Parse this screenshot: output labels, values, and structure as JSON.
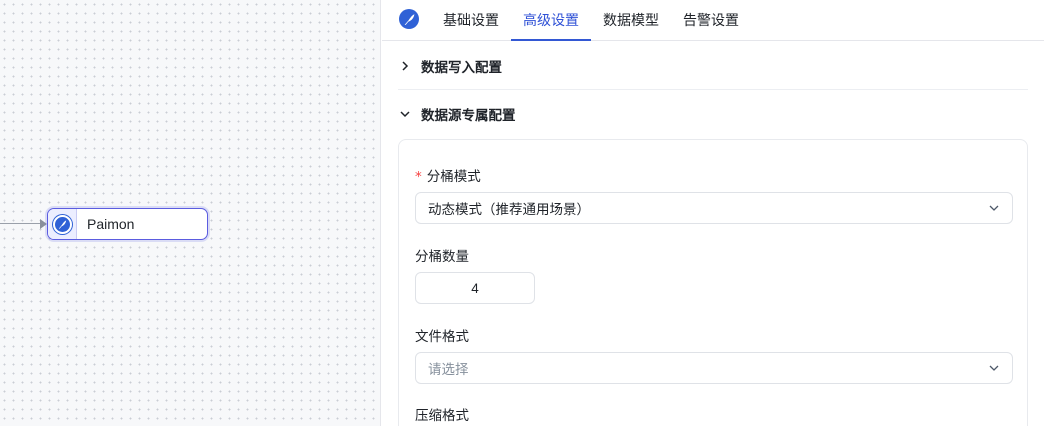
{
  "canvas": {
    "node": {
      "label": "Paimon",
      "icon": "paimon-feather-icon"
    }
  },
  "panel": {
    "logo_icon": "paimon-feather-icon",
    "tabs": [
      {
        "label": "基础设置",
        "active": false
      },
      {
        "label": "高级设置",
        "active": true
      },
      {
        "label": "数据模型",
        "active": false
      },
      {
        "label": "告警设置",
        "active": false
      }
    ],
    "sections": {
      "write_config": {
        "title": "数据写入配置",
        "expanded": false
      },
      "source_config": {
        "title": "数据源专属配置",
        "expanded": true
      }
    },
    "form": {
      "bucket_mode": {
        "required_mark": "*",
        "label": "分桶模式",
        "value": "动态模式（推荐通用场景）"
      },
      "bucket_count": {
        "label": "分桶数量",
        "value": "4"
      },
      "file_format": {
        "label": "文件格式",
        "placeholder": "请选择"
      },
      "compression_format": {
        "label": "压缩格式"
      }
    }
  },
  "colors": {
    "accent": "#2f51d6",
    "node_border": "#5b5ce0",
    "required": "#f53f3f",
    "placeholder": "#86909c"
  }
}
